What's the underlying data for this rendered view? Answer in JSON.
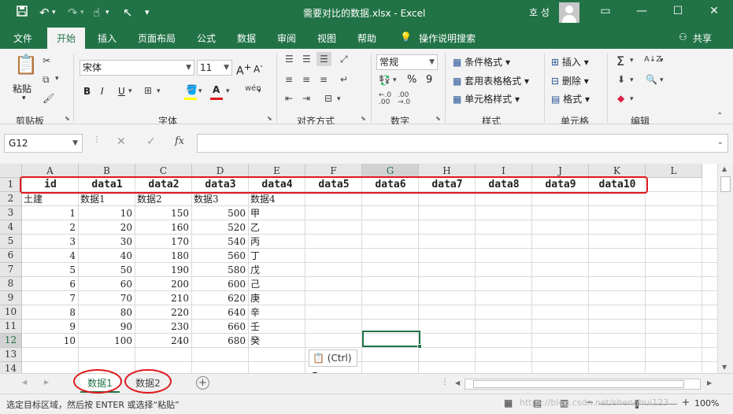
{
  "window": {
    "title": "需要对比的数据.xlsx  -  Excel",
    "user": "호 성",
    "qa_icons": [
      "save-icon",
      "undo-icon",
      "redo-icon",
      "touch-mode-icon",
      "cursor-icon",
      "customize-icon"
    ],
    "controls": {
      "ribbon_options": "▭",
      "minimize": "—",
      "maximize": "☐",
      "close": "✕"
    }
  },
  "ribbon_tabs": [
    {
      "label": "文件",
      "active": false
    },
    {
      "label": "开始",
      "active": true
    },
    {
      "label": "插入",
      "active": false
    },
    {
      "label": "页面布局",
      "active": false
    },
    {
      "label": "公式",
      "active": false
    },
    {
      "label": "数据",
      "active": false
    },
    {
      "label": "审阅",
      "active": false
    },
    {
      "label": "视图",
      "active": false
    },
    {
      "label": "帮助",
      "active": false
    },
    {
      "label": "操作说明搜索",
      "active": false
    }
  ],
  "share_label": "共享",
  "ribbon": {
    "clipboard": {
      "paste": "粘贴",
      "group": "剪贴板"
    },
    "font": {
      "name": "宋体",
      "size": "11",
      "bold": "B",
      "italic": "I",
      "underline": "U",
      "group": "字体"
    },
    "alignment": {
      "group": "对齐方式"
    },
    "number": {
      "format": "常规",
      "group": "数字",
      "percent": "%",
      "comma": "9"
    },
    "styles": {
      "conditional": "条件格式",
      "table": "套用表格格式",
      "cell": "单元格样式",
      "group": "样式"
    },
    "cells": {
      "insert": "插入",
      "delete": "删除",
      "format": "格式",
      "group": "单元格"
    },
    "editing": {
      "group": "编辑"
    }
  },
  "formula_bar": {
    "name_box": "G12",
    "fx": "fx",
    "cancel": "✕",
    "enter": "✓",
    "formula": ""
  },
  "columns": [
    "A",
    "B",
    "C",
    "D",
    "E",
    "F",
    "G",
    "H",
    "I",
    "J",
    "K",
    "L"
  ],
  "selected_column": "G",
  "selected_row": "12",
  "rows": [
    "1",
    "2",
    "3",
    "4",
    "5",
    "6",
    "7",
    "8",
    "9",
    "10",
    "11",
    "12",
    "13",
    "14"
  ],
  "sheet": {
    "header_row": [
      "id",
      "data1",
      "data2",
      "data3",
      "data4",
      "data5",
      "data6",
      "data7",
      "data8",
      "data9",
      "data10"
    ],
    "row2": [
      "土建",
      "数据1",
      "数据2",
      "数据3",
      "数据4"
    ],
    "data": [
      [
        "1",
        "10",
        "150",
        "500",
        "甲"
      ],
      [
        "2",
        "20",
        "160",
        "520",
        "乙"
      ],
      [
        "3",
        "30",
        "170",
        "540",
        "丙"
      ],
      [
        "4",
        "40",
        "180",
        "560",
        "丁"
      ],
      [
        "5",
        "50",
        "190",
        "580",
        "戊"
      ],
      [
        "6",
        "60",
        "200",
        "600",
        "己"
      ],
      [
        "7",
        "70",
        "210",
        "620",
        "庚"
      ],
      [
        "8",
        "80",
        "220",
        "640",
        "辛"
      ],
      [
        "9",
        "90",
        "230",
        "660",
        "壬"
      ],
      [
        "10",
        "100",
        "240",
        "680",
        "癸"
      ]
    ]
  },
  "paste_options": "(Ctrl)",
  "sheet_tabs": [
    {
      "label": "数据1",
      "active": true
    },
    {
      "label": "数据2",
      "active": false
    }
  ],
  "add_sheet": "+",
  "status": {
    "message": "选定目标区域，然后按 ENTER 或选择“粘贴”",
    "zoom": "100%",
    "watermark": "https://blog.csdn.net/shenghui123"
  }
}
